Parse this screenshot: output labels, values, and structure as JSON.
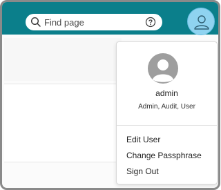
{
  "header": {
    "search": {
      "placeholder": "Find page"
    },
    "colors": {
      "bar": "#0b7f8b",
      "avatar": "#8fd3f0"
    },
    "icons": {
      "search": "search-icon",
      "help": "help-circle-icon",
      "user": "user-icon"
    }
  },
  "user_menu": {
    "username": "admin",
    "roles": "Admin, Audit, User",
    "items": [
      {
        "label": "Edit User"
      },
      {
        "label": "Change Passphrase"
      },
      {
        "label": "Sign Out"
      }
    ]
  }
}
